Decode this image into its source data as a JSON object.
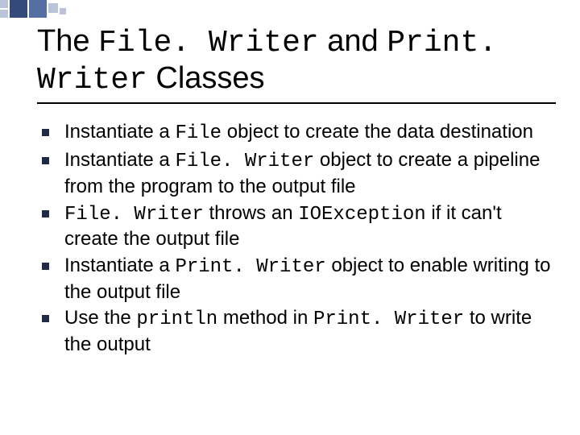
{
  "title": {
    "t1": "The ",
    "t2": "File. Writer",
    "t3": " and ",
    "t4": "Print. Writer",
    "t5": " Classes"
  },
  "bullets": [
    {
      "a": "Instantiate a ",
      "b": "File",
      "c": " object to create the data destination"
    },
    {
      "a": "Instantiate a ",
      "b": "File. Writer",
      "c": " object to create a pipeline from the program to the output file"
    },
    {
      "a": "",
      "b": "File. Writer",
      "c": " throws an ",
      "d": "IOException",
      "e": " if it can't create the output file"
    },
    {
      "a": "Instantiate a ",
      "b": "Print. Writer",
      "c": " object to enable writing to the output file"
    },
    {
      "a": "Use the ",
      "b": "println",
      "c": " method in ",
      "d": "Print. Writer",
      "e": " to write the output"
    }
  ]
}
